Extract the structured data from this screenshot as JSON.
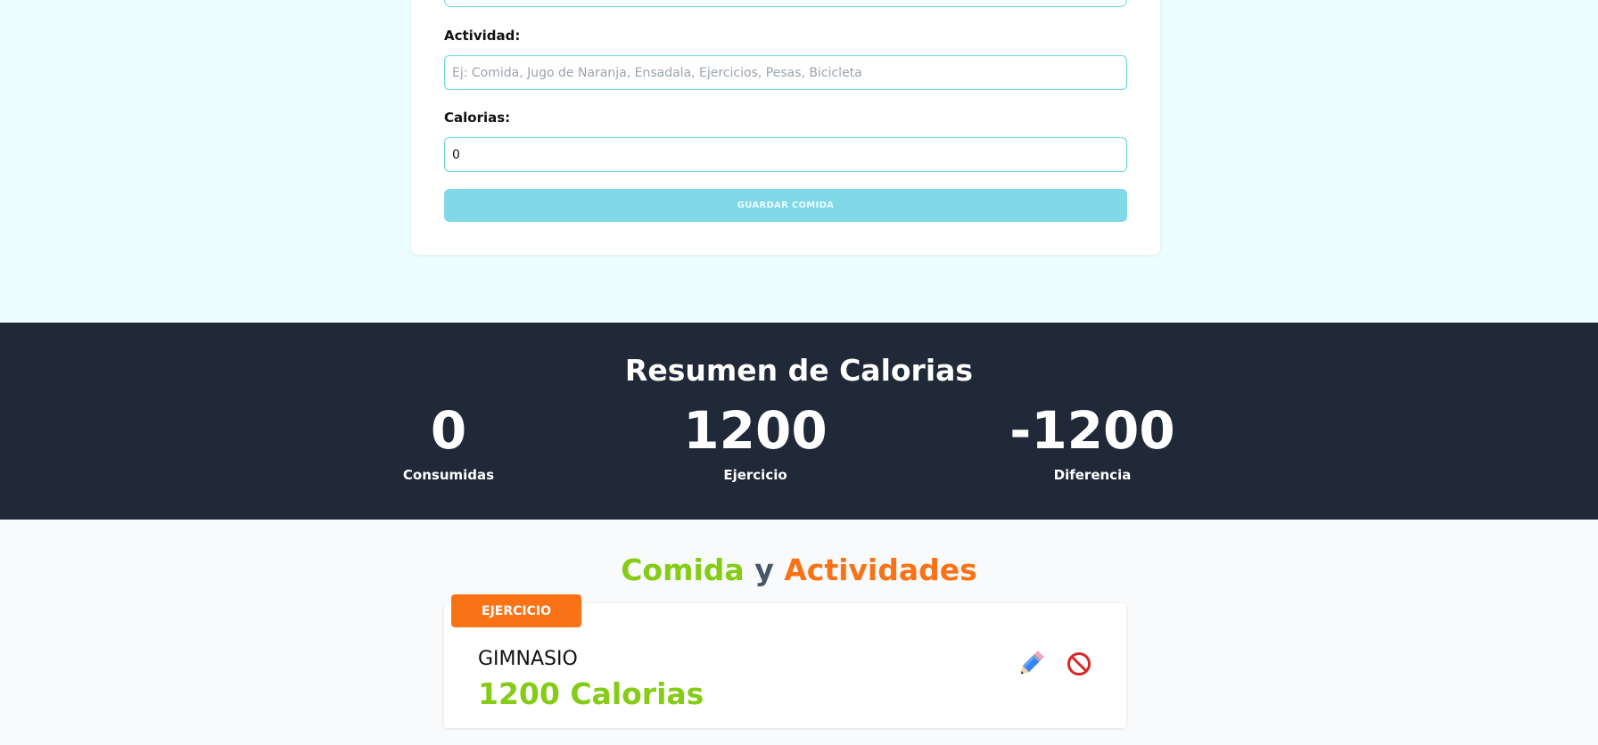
{
  "form": {
    "activity_label": "Actividad:",
    "activity_placeholder": "Ej: Comida, Jugo de Naranja, Ensadala, Ejercicios, Pesas, Bicicleta",
    "calories_label": "Calorias:",
    "calories_value": "0",
    "save_label": "GUARDAR COMIDA"
  },
  "summary": {
    "title": "Resumen de Calorias",
    "stats": [
      {
        "value": "0",
        "label": "Consumidas"
      },
      {
        "value": "1200",
        "label": "Ejercicio"
      },
      {
        "value": "-1200",
        "label": "Diferencia"
      }
    ]
  },
  "list": {
    "title_part1": "Comida",
    "title_part2": "y",
    "title_part3": "Actividades",
    "items": [
      {
        "category": "EJERCICIO",
        "name": "GIMNASIO",
        "calories": "1200 Calorias"
      }
    ]
  },
  "colors": {
    "accent_cyan": "#67d3e6",
    "summary_bg": "#1f2937",
    "green": "#84cc16",
    "orange": "#f97316"
  },
  "icons": [
    "pencil-icon",
    "no-entry-icon"
  ]
}
